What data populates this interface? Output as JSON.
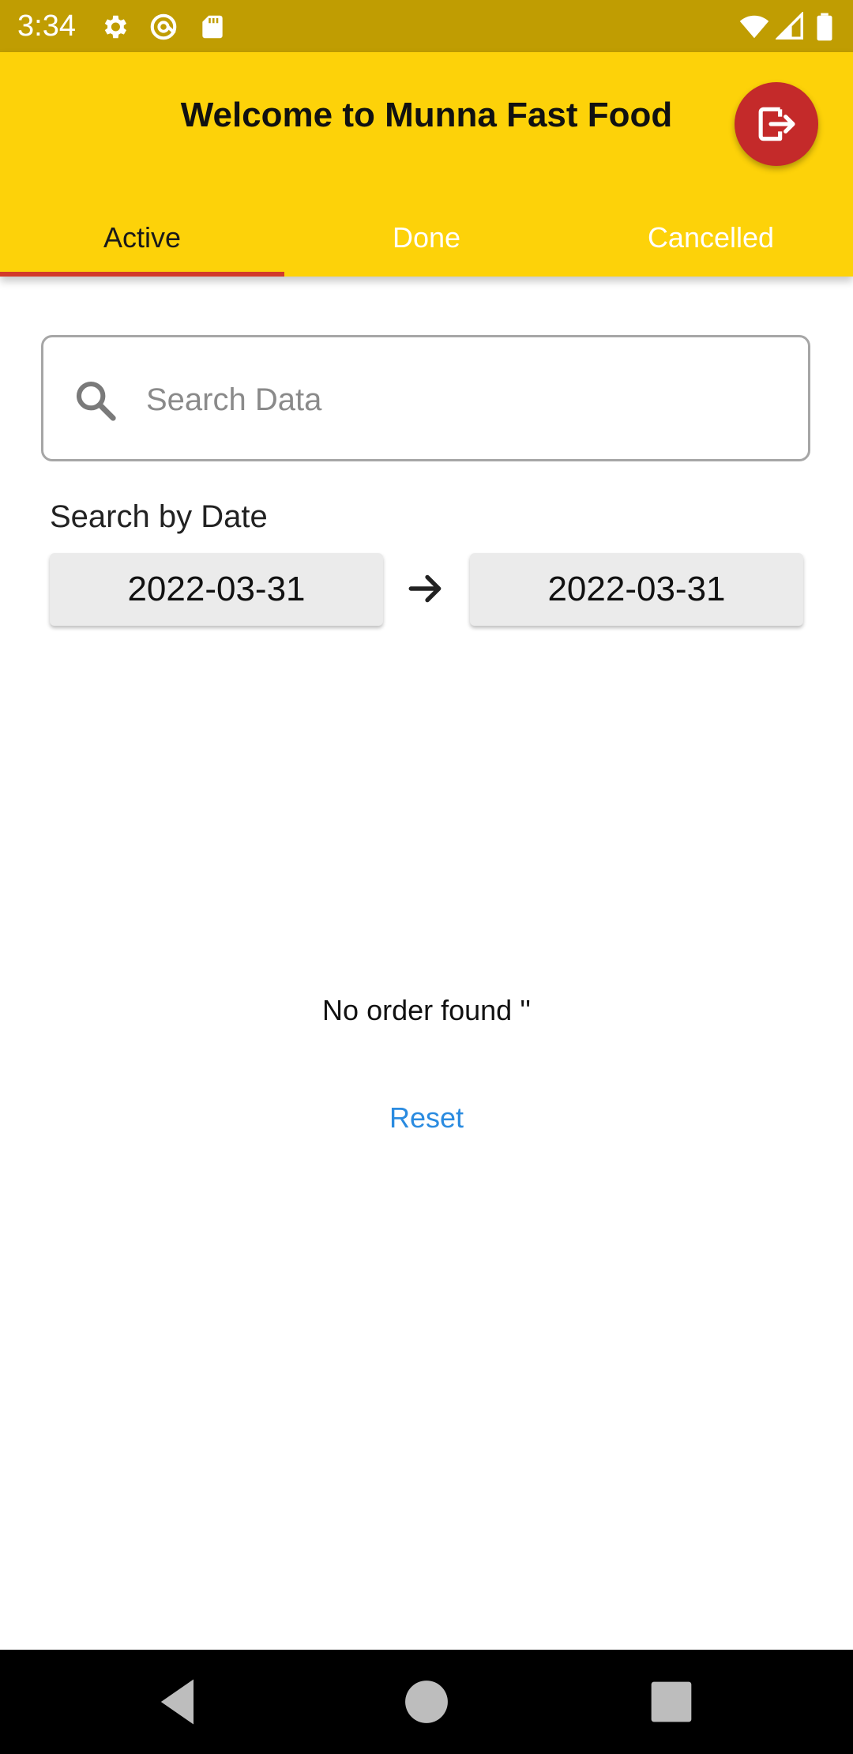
{
  "status_bar": {
    "time": "3:34",
    "icons": [
      "gear-icon",
      "at-sign-icon",
      "sd-card-icon",
      "wifi-icon",
      "signal-icon",
      "battery-icon"
    ]
  },
  "header": {
    "title": "Welcome to Munna Fast Food",
    "logout_icon": "logout-icon"
  },
  "tabs": [
    {
      "label": "Active",
      "selected": true
    },
    {
      "label": "Done",
      "selected": false
    },
    {
      "label": "Cancelled",
      "selected": false
    }
  ],
  "search": {
    "placeholder": "Search Data",
    "value": ""
  },
  "date_filter": {
    "label": "Search by Date",
    "from": "2022-03-31",
    "to": "2022-03-31"
  },
  "empty_state": {
    "message": "No order found ''",
    "reset_label": "Reset"
  },
  "colors": {
    "status_bar": "#C09D02",
    "header": "#FDD209",
    "tab_indicator": "#D23A2A",
    "logout_button": "#C42A2A",
    "link": "#2A8BE0"
  },
  "nav": [
    "back-icon",
    "home-icon",
    "recents-icon"
  ]
}
